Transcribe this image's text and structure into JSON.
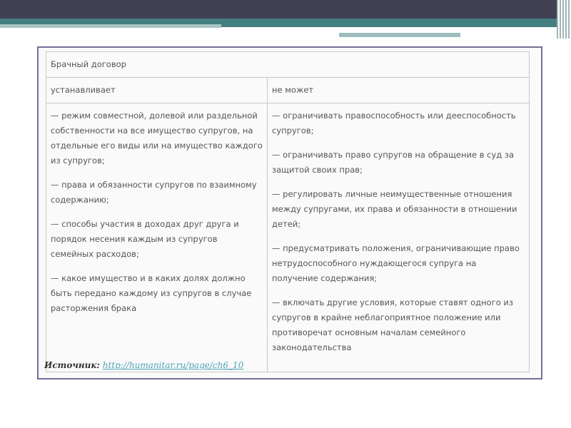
{
  "table": {
    "title": "Брачный договор",
    "col1_header": "устанавливает",
    "col2_header": "не может",
    "col1_items": [
      "— режим совместной, долевой или раздельной собственности на все имущество супругов, на отдельные его виды или на имущество каждого из супругов;",
      "— права и обязанности супругов по взаимному содержанию;",
      "— способы участия в доходах друг друга и порядок несения каждым из супругов семейных расходов;",
      "— какое имущество и в каких долях должно быть передано каждому из супругов в случае расторжения брака"
    ],
    "col2_items": [
      "— ограничивать правоспособность или дееспособность супругов;",
      "— ограничивать право супругов на обращение в суд за защитой своих прав;",
      "— регулировать личные неимущественные отношения между супругами, их права и обязанности в отношении детей;",
      "— предусматривать положения, ограничивающие право нетрудоспособного нуждающегося супруга на получение содержания;",
      "— включать другие условия, которые ставят одного из супругов в крайне неблагоприятное положение или противоречат основным началам семейного законодательства"
    ]
  },
  "source": {
    "label": "Источник:",
    "link": "http://humanitar.ru/page/ch6_10"
  }
}
